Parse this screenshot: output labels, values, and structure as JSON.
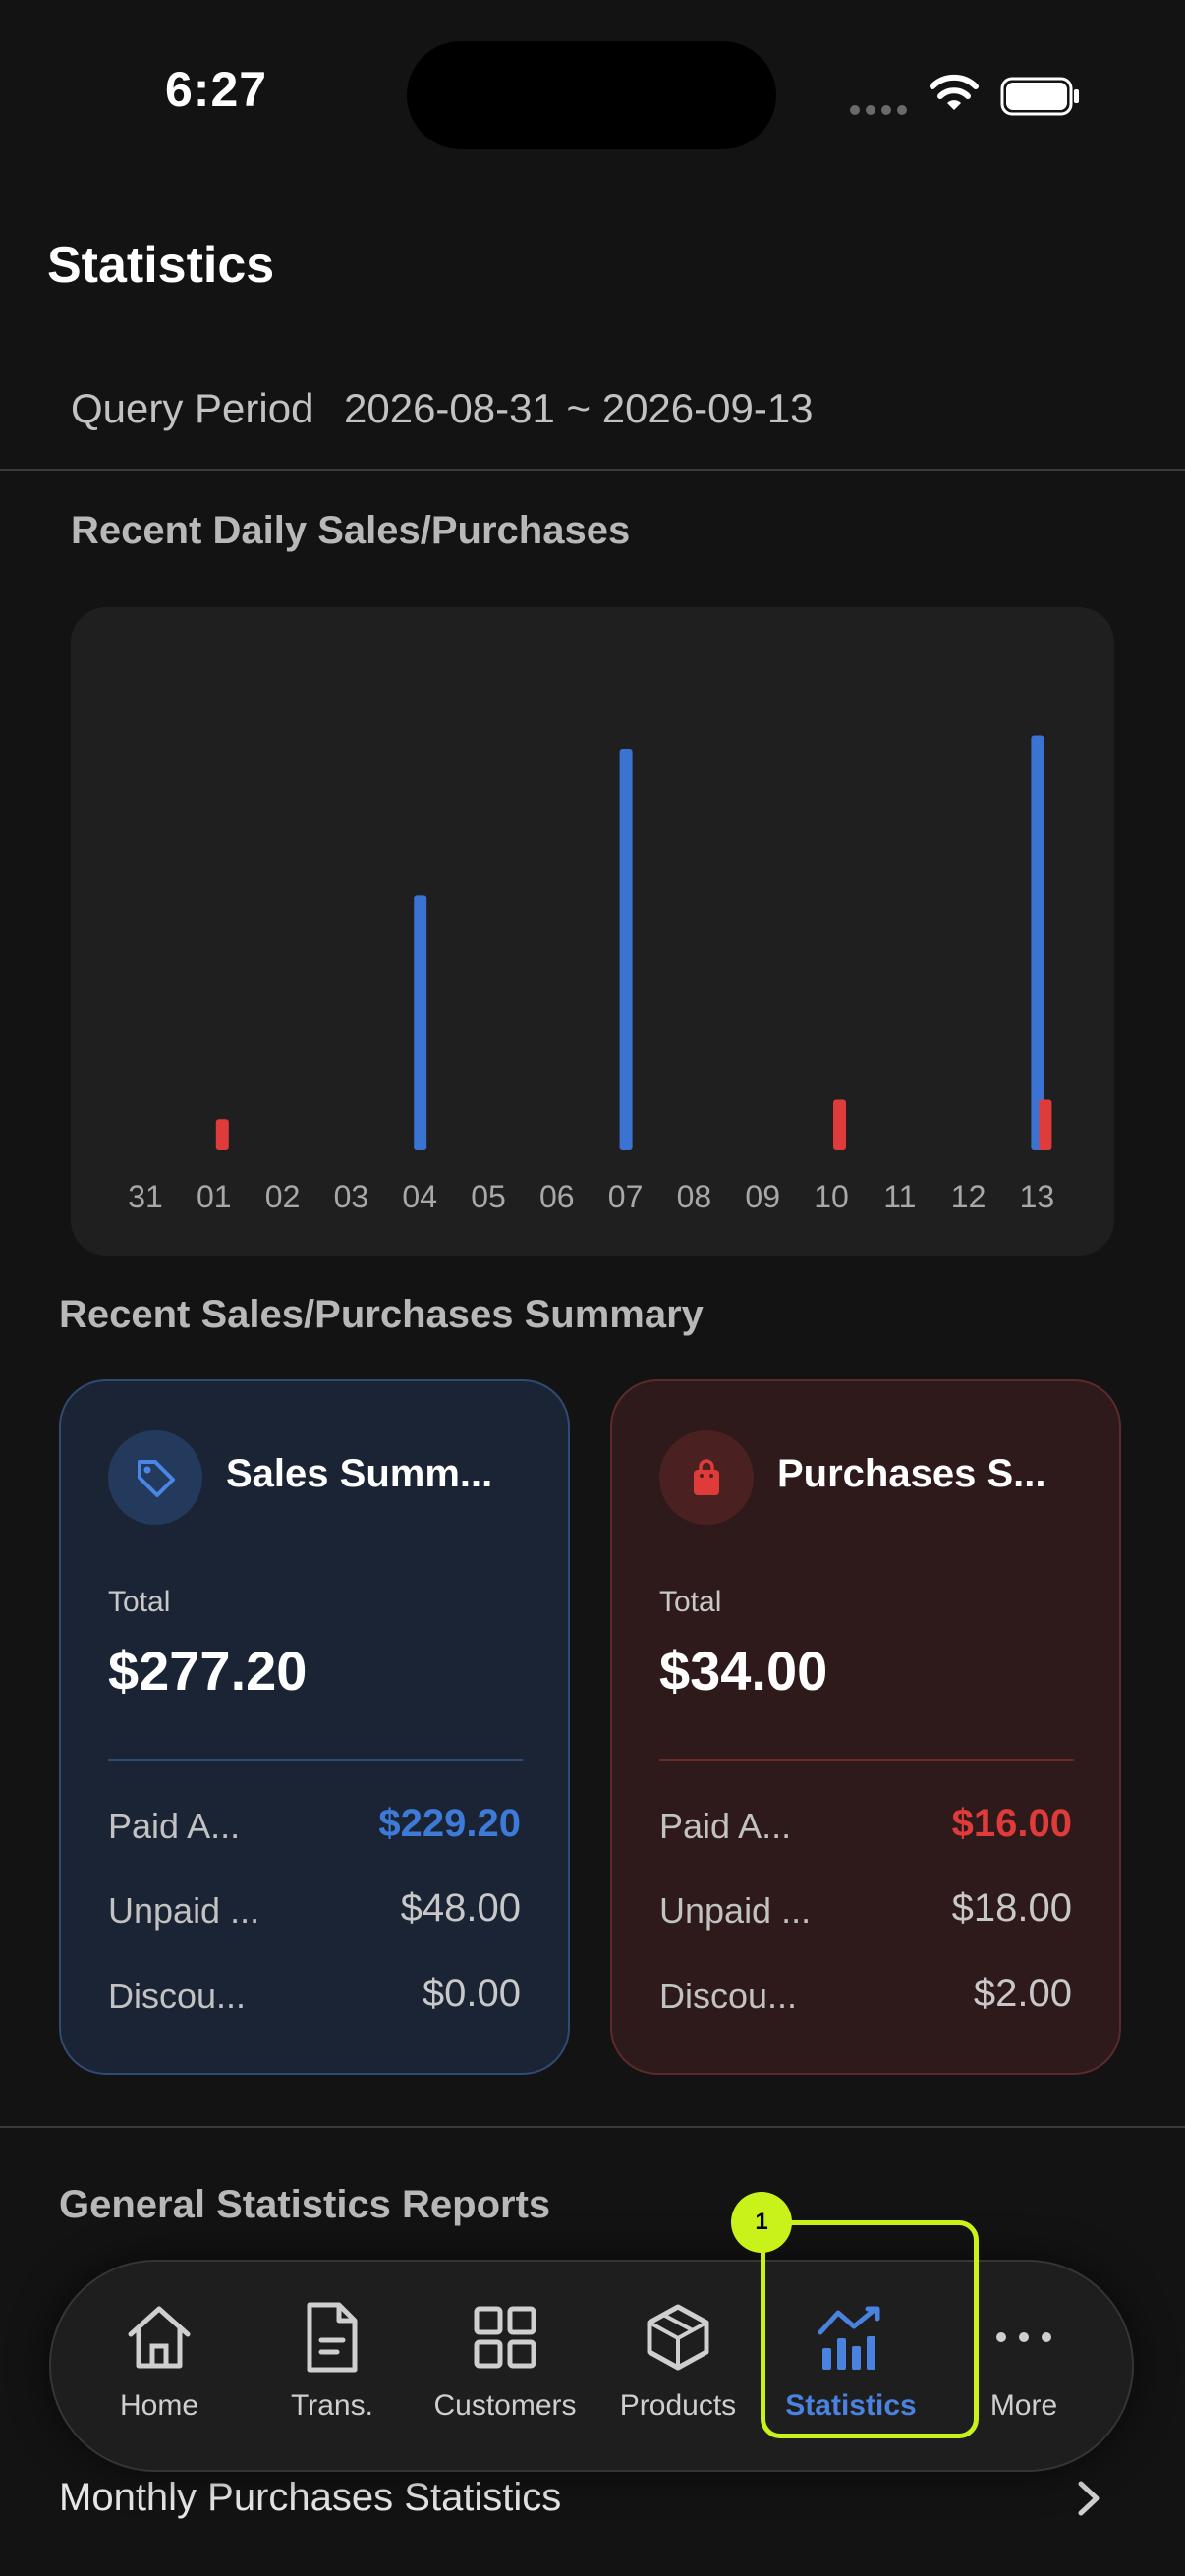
{
  "status_bar": {
    "time": "6:27"
  },
  "header": {
    "title": "Statistics"
  },
  "query": {
    "label": "Query Period",
    "value": "2026-08-31 ~ 2026-09-13"
  },
  "daily_section": {
    "title": "Recent Daily Sales/Purchases"
  },
  "chart_data": {
    "type": "bar",
    "categories": [
      "31",
      "01",
      "02",
      "03",
      "04",
      "05",
      "06",
      "07",
      "08",
      "09",
      "10",
      "11",
      "12",
      "13"
    ],
    "series": [
      {
        "values": [
          0,
          0,
          0,
          0,
          65.5,
          0,
          0,
          103.2,
          0,
          0,
          0,
          0,
          0,
          106.6
        ]
      },
      {
        "values": [
          0,
          8,
          0,
          0,
          0,
          0,
          0,
          0,
          0,
          0,
          13,
          0,
          0,
          13
        ]
      }
    ],
    "ylim": [
      0,
      110
    ],
    "colors": [
      "#3b73d2",
      "#df3b3b"
    ]
  },
  "summary_section": {
    "title": "Recent Sales/Purchases Summary"
  },
  "sales_card": {
    "icon": "tag-icon",
    "title": "Sales Summ...",
    "total_label": "Total",
    "total_value": "$277.20",
    "paid_label": "Paid A...",
    "paid_value": "$229.20",
    "unpaid_label": "Unpaid ...",
    "unpaid_value": "$48.00",
    "discount_label": "Discou...",
    "discount_value": "$0.00"
  },
  "purchases_card": {
    "icon": "shopping-bag-icon",
    "title": "Purchases S...",
    "total_label": "Total",
    "total_value": "$34.00",
    "paid_label": "Paid A...",
    "paid_value": "$16.00",
    "unpaid_label": "Unpaid ...",
    "unpaid_value": "$18.00",
    "discount_label": "Discou...",
    "discount_value": "$2.00"
  },
  "reports_section": {
    "title": "General Statistics Reports"
  },
  "nav": {
    "items": [
      {
        "label": "Home",
        "icon": "home-icon"
      },
      {
        "label": "Trans.",
        "icon": "document-icon"
      },
      {
        "label": "Customers",
        "icon": "grid-icon"
      },
      {
        "label": "Products",
        "icon": "box-icon"
      },
      {
        "label": "Statistics",
        "icon": "bar-chart-icon",
        "active": true
      },
      {
        "label": "More",
        "icon": "more-icon"
      }
    ]
  },
  "annotation": {
    "marker": "1"
  },
  "report_row": {
    "label": "Monthly Purchases Statistics"
  }
}
